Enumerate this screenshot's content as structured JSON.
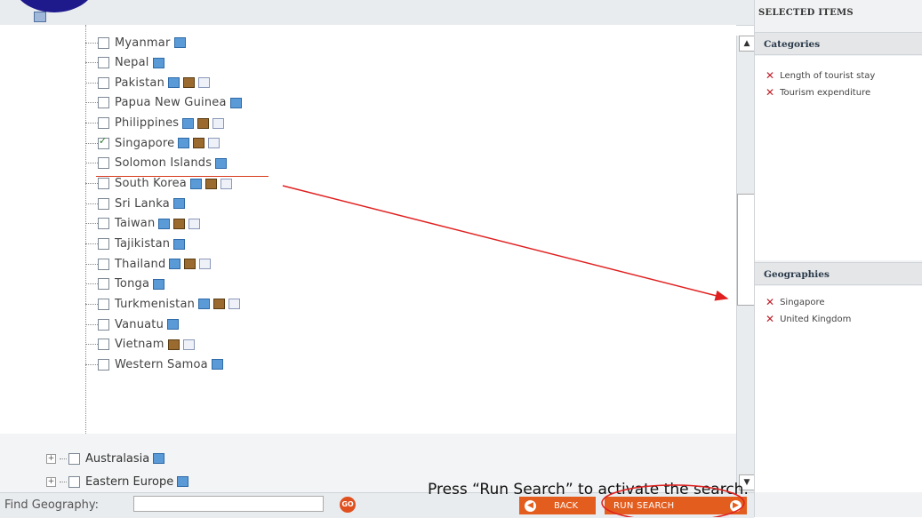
{
  "right_panel": {
    "title": "SELECTED ITEMS",
    "categories_heading": "Categories",
    "categories": [
      "Length of tourist stay",
      "Tourism expenditure"
    ],
    "geographies_heading": "Geographies",
    "geographies": [
      "Singapore",
      "United Kingdom"
    ]
  },
  "tree": {
    "countries": [
      {
        "label": "Myanmar",
        "checked": false,
        "icons": [
          "data"
        ]
      },
      {
        "label": "Nepal",
        "checked": false,
        "icons": [
          "data"
        ]
      },
      {
        "label": "Pakistan",
        "checked": false,
        "icons": [
          "data",
          "book",
          "doc"
        ]
      },
      {
        "label": "Papua New Guinea",
        "checked": false,
        "icons": [
          "data"
        ]
      },
      {
        "label": "Philippines",
        "checked": false,
        "icons": [
          "data",
          "book",
          "doc"
        ]
      },
      {
        "label": "Singapore",
        "checked": true,
        "icons": [
          "data",
          "book",
          "doc"
        ]
      },
      {
        "label": "Solomon Islands",
        "checked": false,
        "icons": [
          "data"
        ]
      },
      {
        "label": "South Korea",
        "checked": false,
        "icons": [
          "data",
          "book",
          "doc"
        ]
      },
      {
        "label": "Sri Lanka",
        "checked": false,
        "icons": [
          "data"
        ]
      },
      {
        "label": "Taiwan",
        "checked": false,
        "icons": [
          "data",
          "book",
          "doc"
        ]
      },
      {
        "label": "Tajikistan",
        "checked": false,
        "icons": [
          "data"
        ]
      },
      {
        "label": "Thailand",
        "checked": false,
        "icons": [
          "data",
          "book",
          "doc"
        ]
      },
      {
        "label": "Tonga",
        "checked": false,
        "icons": [
          "data"
        ]
      },
      {
        "label": "Turkmenistan",
        "checked": false,
        "icons": [
          "data",
          "book",
          "doc"
        ]
      },
      {
        "label": "Vanuatu",
        "checked": false,
        "icons": [
          "data"
        ]
      },
      {
        "label": "Vietnam",
        "checked": false,
        "icons": [
          "book",
          "doc"
        ]
      },
      {
        "label": "Western Samoa",
        "checked": false,
        "icons": [
          "data"
        ]
      }
    ],
    "groups": [
      {
        "label": "Australasia",
        "checked": false
      },
      {
        "label": "Eastern Europe",
        "checked": false
      }
    ]
  },
  "bottom_bar": {
    "find_label": "Find Geography:",
    "find_value": "",
    "go_label": "GO",
    "back_label": "BACK",
    "run_label": "RUN SEARCH"
  },
  "annotation": {
    "text": "Press “Run Search” to activate the search.",
    "color": "#e02020"
  }
}
